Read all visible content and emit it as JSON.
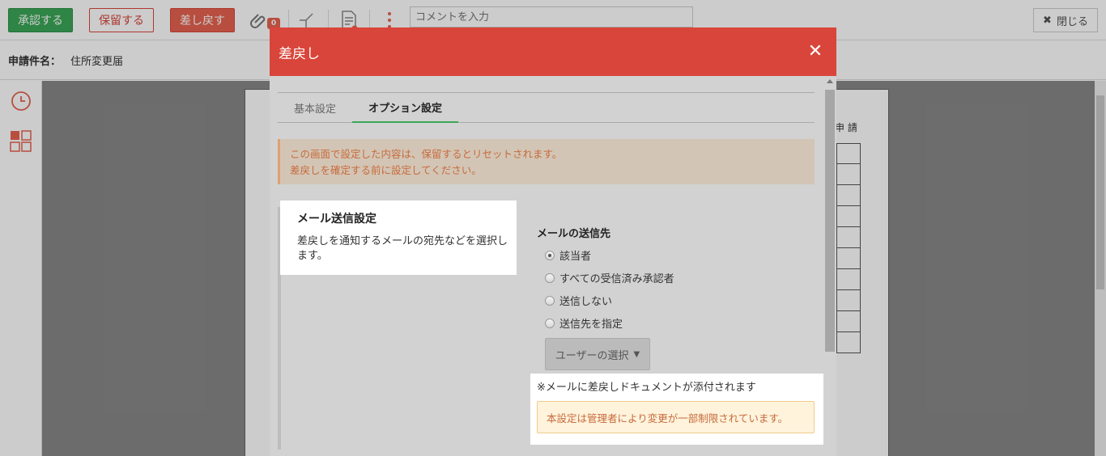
{
  "toolbar": {
    "approve_label": "承認する",
    "hold_label": "保留する",
    "return_label": "差し戻す",
    "attachment_count": "0",
    "comment_placeholder": "コメントを入力",
    "close_label": "閉じる"
  },
  "request": {
    "name_label": "申請件名：",
    "name_value": "住所変更届"
  },
  "document": {
    "header_text": "申 請"
  },
  "modal": {
    "title": "差戻し",
    "tabs": [
      {
        "label": "基本設定",
        "active": false
      },
      {
        "label": "オプション設定",
        "active": true
      }
    ],
    "info_line1": "この画面で設定した内容は、保留するとリセットされます。",
    "info_line2": "差戻しを確定する前に設定してください。",
    "mail_section": {
      "title": "メール送信設定",
      "description": "差戻しを通知するメールの宛先などを選択します。"
    },
    "destination": {
      "title": "メールの送信先",
      "options": [
        {
          "label": "該当者",
          "checked": true
        },
        {
          "label": "すべての受信済み承認者",
          "checked": false
        },
        {
          "label": "送信しない",
          "checked": false
        },
        {
          "label": "送信先を指定",
          "checked": false
        }
      ],
      "user_select_label": "ユーザーの選択"
    },
    "attach_note": "※メールに差戻しドキュメントが添付されます",
    "restriction_warning": "本設定は管理者により変更が一部制限されています。"
  },
  "colors": {
    "header_red": "#d9453a",
    "approve_green": "#3aa757",
    "warning_orange": "#c76b3c"
  }
}
